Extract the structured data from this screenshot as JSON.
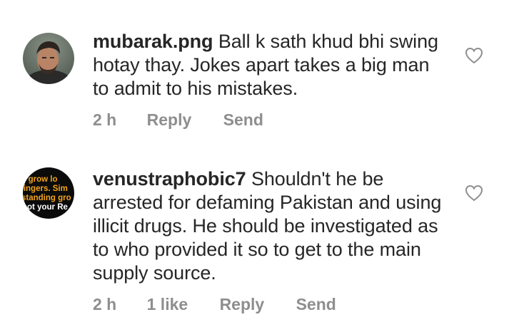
{
  "comments": [
    {
      "username": "mubarak.png",
      "text": "Ball k sath khud bhi swing hotay thay. Jokes apart takes a big man to admit to his mistakes.",
      "time": "2 h",
      "likes": "",
      "reply_label": "Reply",
      "send_label": "Send",
      "avatar_icon": "profile-photo-man",
      "like_icon": "heart-outline-icon"
    },
    {
      "username": "venustraphobic7",
      "text": "Shouldn't he be arrested for defaming Pakistan and using illicit drugs. He should be investigated as to who provided it so to get to the main supply source.",
      "time": "2 h",
      "likes": "1 like",
      "reply_label": "Reply",
      "send_label": "Send",
      "avatar_icon": "text-quote-image",
      "avatar_text_lines": [
        "s grow lo",
        "fingers. Sim",
        "standing gro",
        "not your Re"
      ],
      "like_icon": "heart-outline-icon"
    }
  ],
  "colors": {
    "text": "#262626",
    "meta": "#8e8e8e",
    "avatar_quote_orange": "#f2a31b"
  }
}
